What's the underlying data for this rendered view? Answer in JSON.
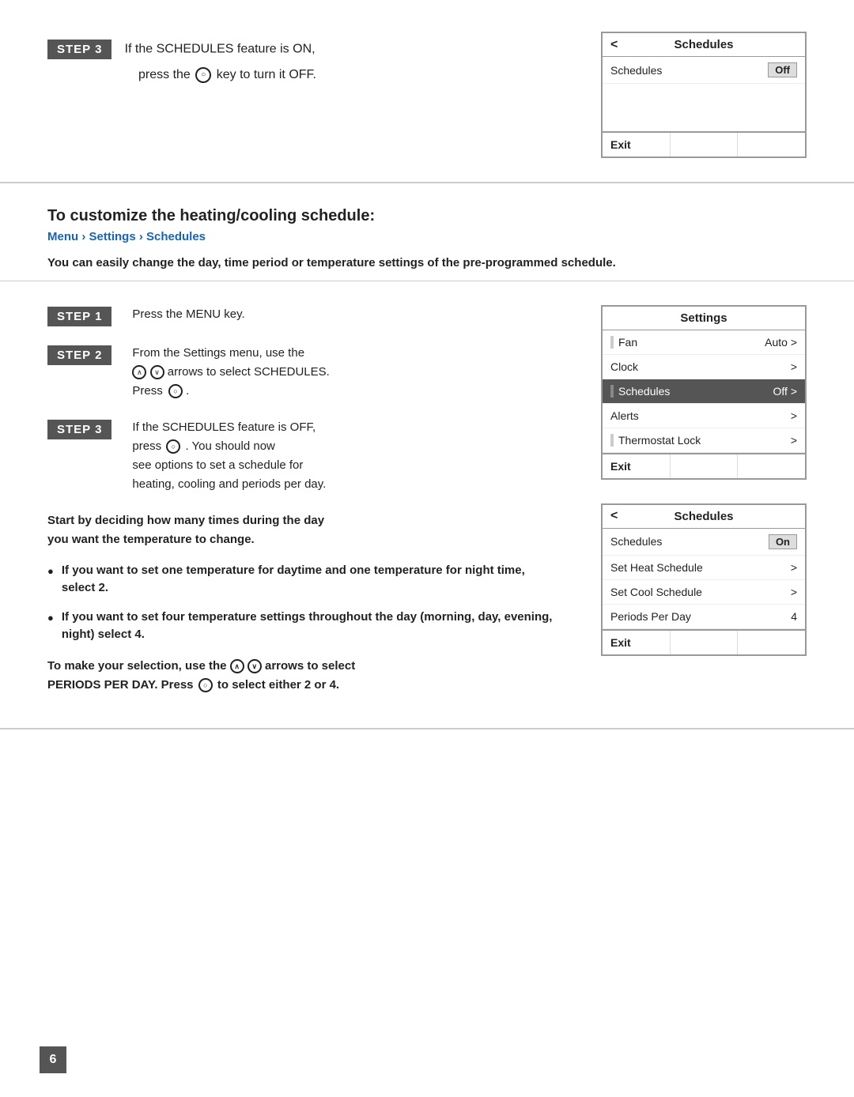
{
  "top": {
    "step_badge": "STEP 3",
    "instruction_line1": "If the SCHEDULES feature is ON,",
    "instruction_line2": "press the",
    "instruction_line3": "key to turn it OFF.",
    "screen1": {
      "title": "Schedules",
      "back_arrow": "<",
      "rows": [
        {
          "label": "Schedules",
          "value": "Off",
          "value_badge": true,
          "arrow": ""
        }
      ],
      "footer": [
        "Exit",
        "",
        ""
      ]
    }
  },
  "heading": {
    "title": "To customize the heating/cooling schedule:",
    "breadcrumb": "Menu › Settings › Schedules",
    "desc": "You can easily change the day, time period or temperature settings of the pre-programmed schedule."
  },
  "steps": [
    {
      "badge": "STEP 1",
      "text": "Press the MENU key."
    },
    {
      "badge": "STEP 2",
      "line1": "From the Settings menu, use the",
      "line2": "arrows to select SCHEDULES.",
      "line3": "Press"
    },
    {
      "badge": "STEP 3",
      "line1": "If the SCHEDULES feature is OFF,",
      "line2": "press",
      "line3": ". You should now",
      "line4": "see options to set a schedule for",
      "line5": "heating, cooling and periods per day."
    }
  ],
  "summary": {
    "line1": "Start by deciding how many times during the day",
    "line2": "you want the temperature to change."
  },
  "bullets": [
    {
      "text": "If you want to set one temperature for daytime and one temperature for night time, select 2."
    },
    {
      "text": "If you want to set four temperature settings throughout the day (morning, day, evening, night) select 4."
    }
  ],
  "selection_text1": "To make your selection, use the",
  "selection_text2": "arrows to select",
  "selection_text3": "PERIODS PER DAY. Press",
  "selection_text4": "to select either 2 or 4.",
  "screen_settings": {
    "title": "Settings",
    "rows": [
      {
        "label": "Fan",
        "value": "Auto",
        "arrow": ">",
        "selected": false
      },
      {
        "label": "Clock",
        "value": "",
        "arrow": ">",
        "selected": false
      },
      {
        "label": "Schedules",
        "value": "Off",
        "arrow": ">",
        "selected": true
      },
      {
        "label": "Alerts",
        "value": "",
        "arrow": ">",
        "selected": false
      },
      {
        "label": "Thermostat Lock",
        "value": "",
        "arrow": ">",
        "selected": false
      }
    ],
    "footer": [
      "Exit",
      "",
      ""
    ]
  },
  "screen_schedules_on": {
    "title": "Schedules",
    "back_arrow": "<",
    "rows": [
      {
        "label": "Schedules",
        "value": "On",
        "value_badge": true,
        "arrow": ""
      },
      {
        "label": "Set Heat Schedule",
        "value": "",
        "arrow": ">",
        "selected": false
      },
      {
        "label": "Set Cool Schedule",
        "value": "",
        "arrow": ">",
        "selected": false
      },
      {
        "label": "Periods Per Day",
        "value": "4",
        "arrow": "",
        "selected": false
      }
    ],
    "footer": [
      "Exit",
      "",
      ""
    ]
  },
  "page_number": "6"
}
